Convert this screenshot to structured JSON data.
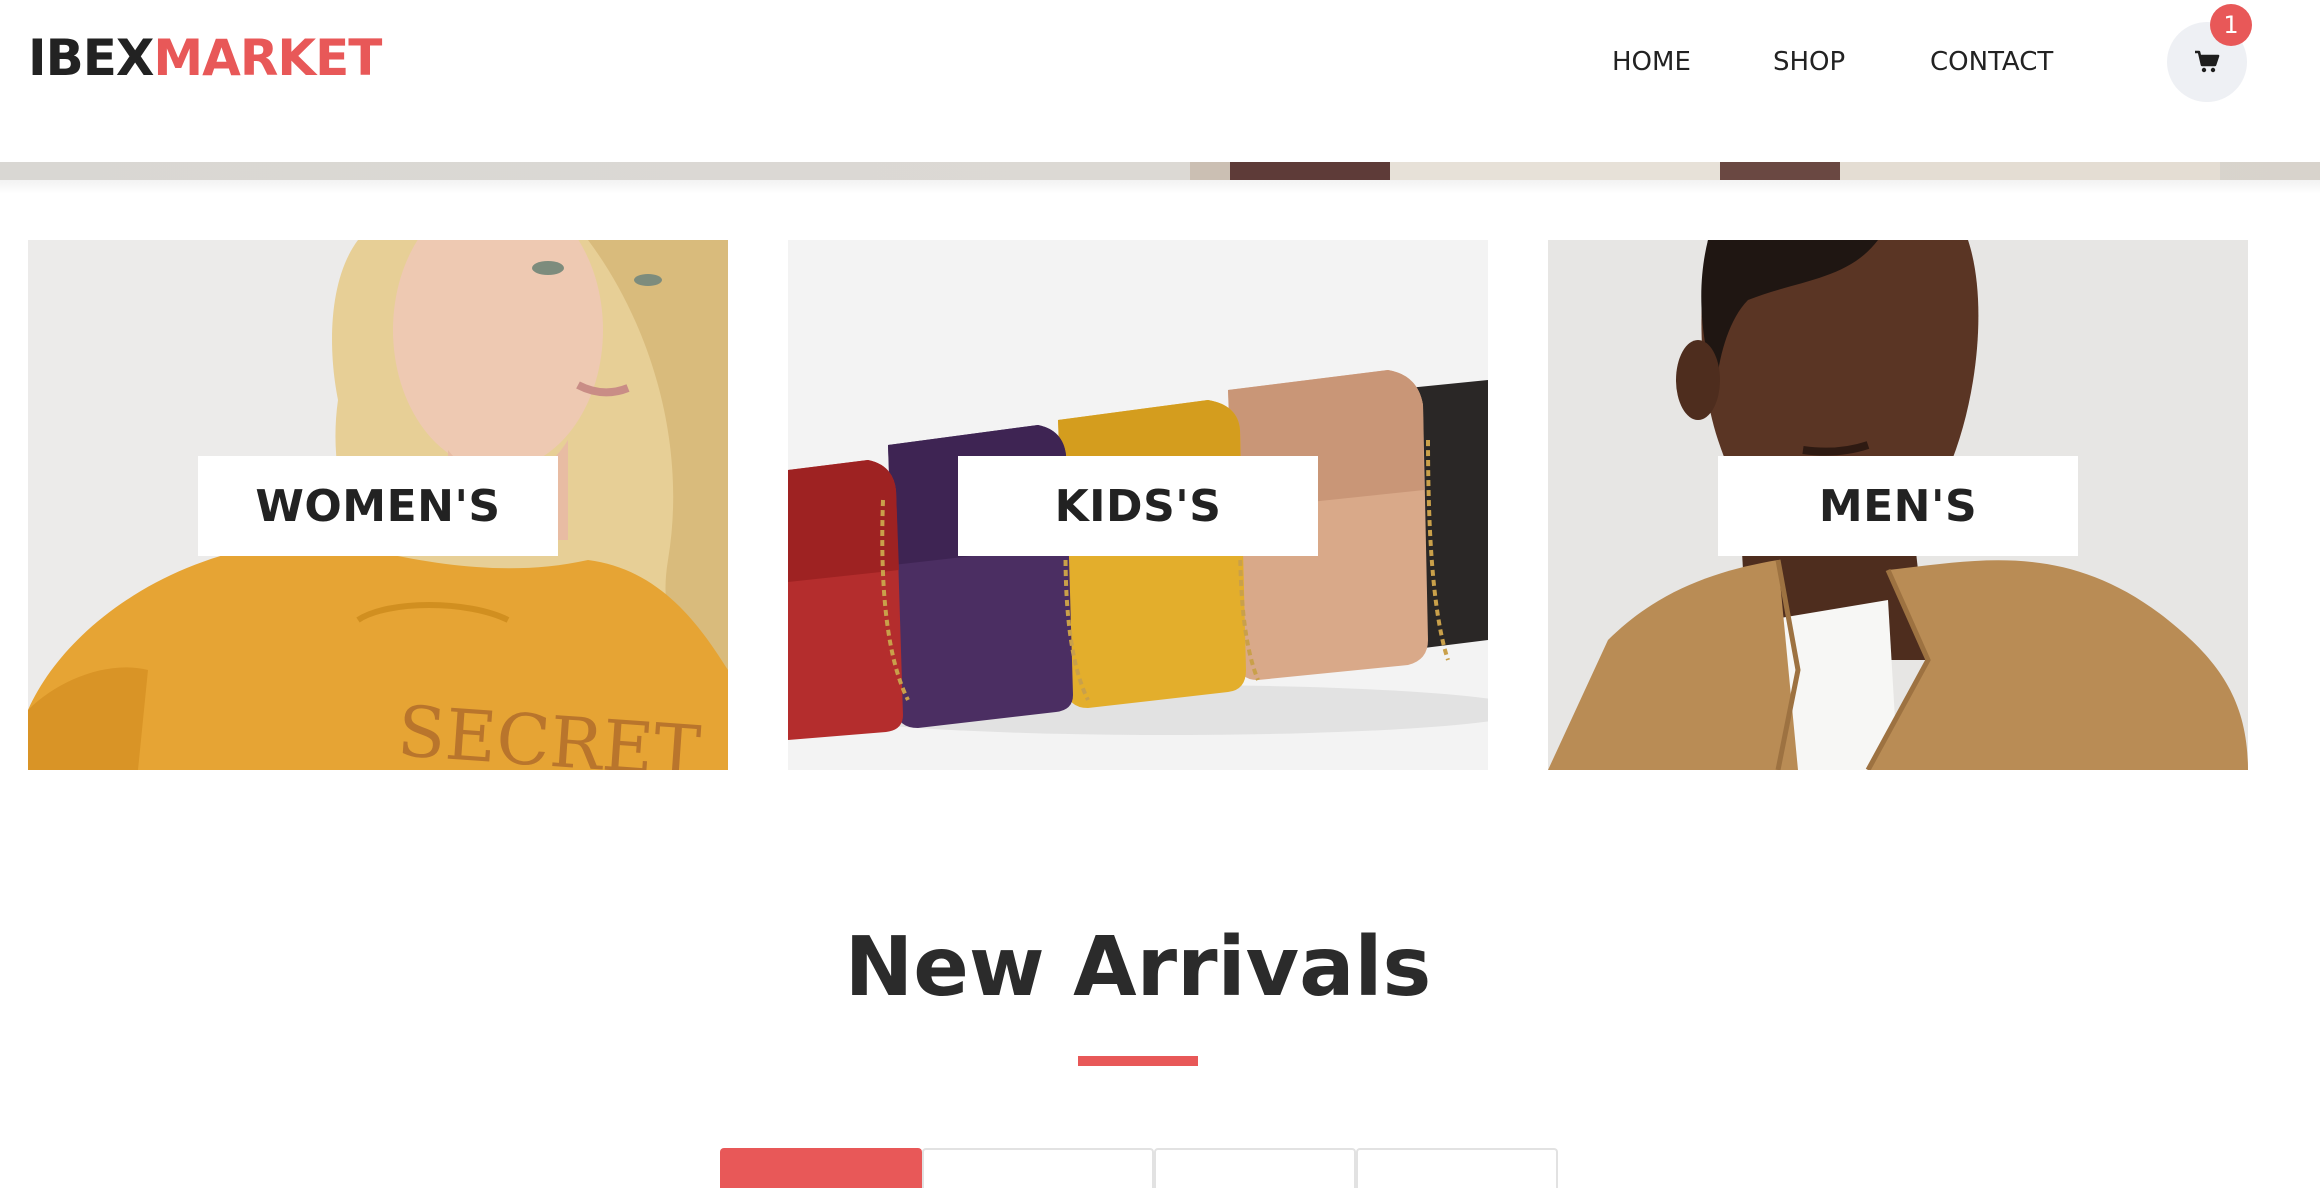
{
  "brand": {
    "part1": "IBEX",
    "part2": "MARKET"
  },
  "nav": {
    "home": "HOME",
    "shop": "SHOP",
    "contact": "CONTACT"
  },
  "cart": {
    "count": "1"
  },
  "categories": [
    {
      "label": "WOMEN'S"
    },
    {
      "label": "KIDS'S"
    },
    {
      "label": "MEN'S"
    }
  ],
  "new_arrivals": {
    "title": "New Arrivals"
  },
  "colors": {
    "accent": "#e85858",
    "text": "#222222",
    "cart_bg": "#eef0f4"
  },
  "icons": {
    "cart": "shopping-cart-icon"
  }
}
